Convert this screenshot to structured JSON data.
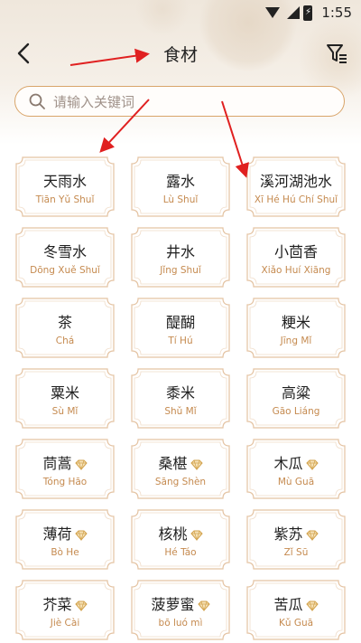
{
  "status": {
    "time": "1:55"
  },
  "header": {
    "title": "食材"
  },
  "search": {
    "placeholder": "请输入关键词"
  },
  "colors": {
    "accent": "#d9a56a",
    "pinyin": "#c58a4f",
    "annotation_arrow": "#e02020"
  },
  "items": [
    {
      "name": "天雨水",
      "pinyin": "Tiān Yǔ Shuǐ",
      "premium": false
    },
    {
      "name": "露水",
      "pinyin": "Lù Shuǐ",
      "premium": false
    },
    {
      "name": "溪河湖池水",
      "pinyin": "Xī Hé Hú Chí Shuǐ",
      "premium": false
    },
    {
      "name": "冬雪水",
      "pinyin": "Dōng Xuě Shuǐ",
      "premium": false
    },
    {
      "name": "井水",
      "pinyin": "Jǐng Shuǐ",
      "premium": false
    },
    {
      "name": "小茴香",
      "pinyin": "Xiǎo Huí Xiāng",
      "premium": false
    },
    {
      "name": "茶",
      "pinyin": "Chá",
      "premium": false
    },
    {
      "name": "醍醐",
      "pinyin": "Tí Hú",
      "premium": false
    },
    {
      "name": "粳米",
      "pinyin": "Jīng Mǐ",
      "premium": false
    },
    {
      "name": "粟米",
      "pinyin": "Sù Mǐ",
      "premium": false
    },
    {
      "name": "黍米",
      "pinyin": "Shǔ Mǐ",
      "premium": false
    },
    {
      "name": "高粱",
      "pinyin": "Gāo Liáng",
      "premium": false
    },
    {
      "name": "茼蒿",
      "pinyin": "Tóng Hāo",
      "premium": true
    },
    {
      "name": "桑椹",
      "pinyin": "Sāng Shèn",
      "premium": true
    },
    {
      "name": "木瓜",
      "pinyin": "Mù Guā",
      "premium": true
    },
    {
      "name": "薄荷",
      "pinyin": "Bò He",
      "premium": true
    },
    {
      "name": "核桃",
      "pinyin": "Hé Táo",
      "premium": true
    },
    {
      "name": "紫苏",
      "pinyin": "Zǐ Sū",
      "premium": true
    },
    {
      "name": "芥菜",
      "pinyin": "Jiè Cài",
      "premium": true
    },
    {
      "name": "菠萝蜜",
      "pinyin": "bō luó mì",
      "premium": true
    },
    {
      "name": "苦瓜",
      "pinyin": "Kǔ Guā",
      "premium": true
    }
  ]
}
